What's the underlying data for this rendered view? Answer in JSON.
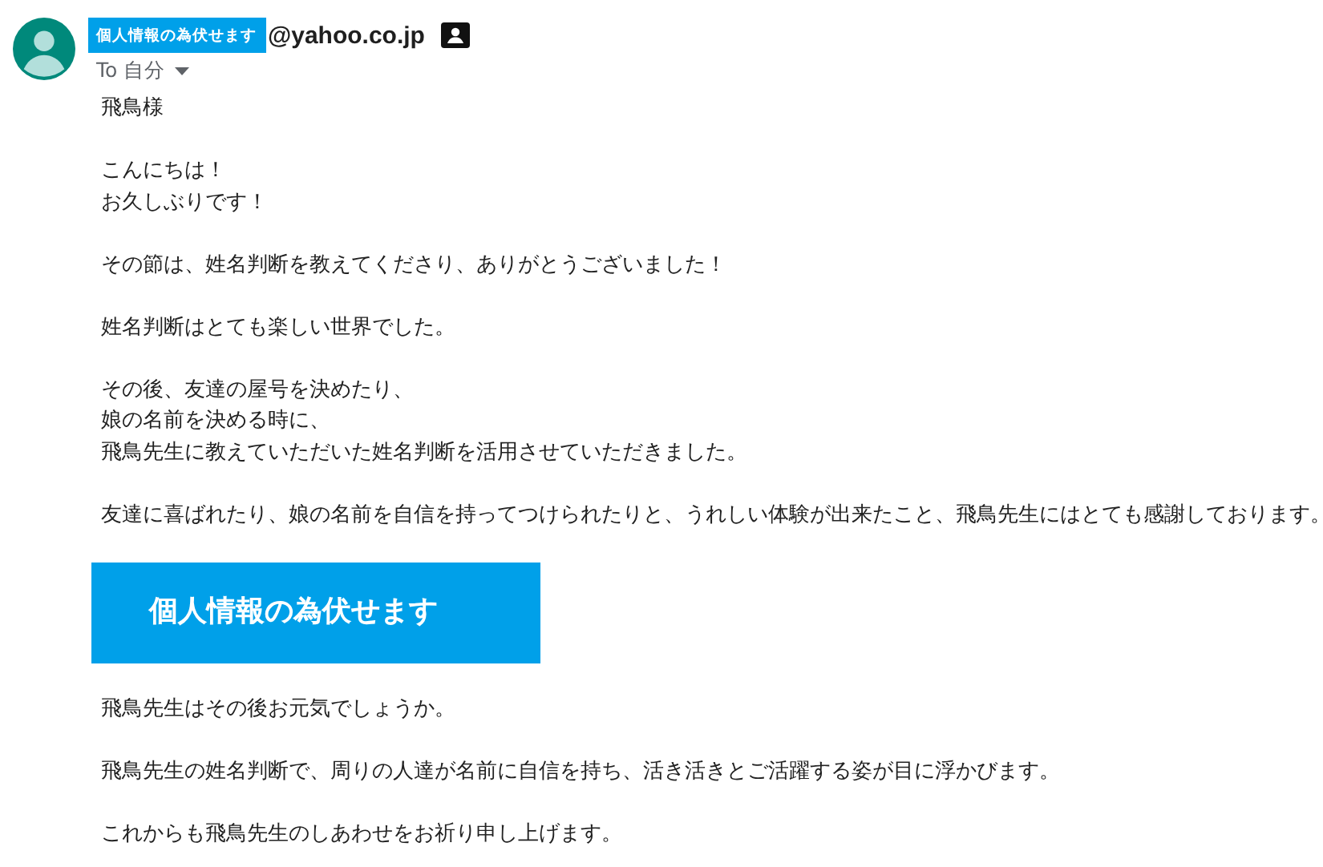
{
  "header": {
    "sender_redaction": "個人情報の為伏せます",
    "sender_address": "@yahoo.co.jp",
    "recipient": "To 自分"
  },
  "body": [
    {
      "kind": "text",
      "lines": [
        "飛鳥様"
      ]
    },
    {
      "kind": "text",
      "lines": [
        "こんにちは！",
        "お久しぶりです！"
      ]
    },
    {
      "kind": "text",
      "lines": [
        "その節は、姓名判断を教えてくださり、ありがとうございました！"
      ]
    },
    {
      "kind": "text",
      "lines": [
        "姓名判断はとても楽しい世界でした。"
      ]
    },
    {
      "kind": "text",
      "lines": [
        "その後、友達の屋号を決めたり、",
        "娘の名前を決める時に、",
        "飛鳥先生に教えていただいた姓名判断を活用させていただきました。"
      ]
    },
    {
      "kind": "text",
      "lines": [
        "友達に喜ばれたり、娘の名前を自信を持ってつけられたりと、うれしい体験が出来たこと、飛鳥先生にはとても感謝しております。"
      ]
    },
    {
      "kind": "banner",
      "text": "個人情報の為伏せます"
    },
    {
      "kind": "text",
      "lines": [
        "飛鳥先生はその後お元気でしょうか。"
      ]
    },
    {
      "kind": "text",
      "lines": [
        "飛鳥先生の姓名判断で、周りの人達が名前に自信を持ち、活き活きとご活躍する姿が目に浮かびます。"
      ]
    },
    {
      "kind": "text",
      "lines": [
        "これからも飛鳥先生のしあわせをお祈り申し上げます。"
      ]
    }
  ]
}
